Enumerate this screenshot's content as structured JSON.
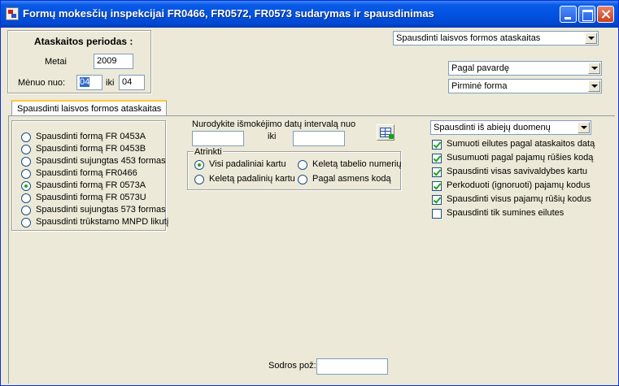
{
  "window": {
    "title": "Formų mokesčių inspekcijai FR0466, FR0572, FR0573 sudarymas  ir spausdinimas"
  },
  "period": {
    "heading": "Ataskaitos periodas :",
    "year_label": "Metai",
    "year_value": "2009",
    "month_from_label": "Mėnuo nuo:",
    "month_from_value": "04",
    "month_to_label": "iki",
    "month_to_value": "04"
  },
  "report_type_select": "Spausdinti laisvos formos ataskaitas",
  "sort_select": "Pagal pavardę",
  "form_select": "Pirminė forma",
  "tab": {
    "label": "Spausdinti laisvos formos ataskaitas"
  },
  "forms": [
    {
      "label": "Spausdinti formą FR 0453A",
      "checked": false
    },
    {
      "label": "Spausdinti formą FR 0453B",
      "checked": false
    },
    {
      "label": "Spausdinti sujungtas 453 formas",
      "checked": false
    },
    {
      "label": "Spausdinti formą FR0466",
      "checked": false
    },
    {
      "label": "Spausdinti formą FR 0573A",
      "checked": true
    },
    {
      "label": "Spausdinti formą FR 0573U",
      "checked": false
    },
    {
      "label": "Spausdinti sujungtas 573 formas",
      "checked": false
    },
    {
      "label": "Spausdinti trūkstamo MNPD likutį",
      "checked": false
    }
  ],
  "date_interval": {
    "label": "Nurodykite išmokėjimo datų intervalą nuo",
    "from_value": "",
    "to_label": "iki",
    "to_value": ""
  },
  "select_group": {
    "title": "Atrinkti",
    "options": [
      {
        "label": "Visi padaliniai kartu",
        "checked": true
      },
      {
        "label": "Keletą tabelio numerių",
        "checked": false
      },
      {
        "label": "Keletą padalinių kartu",
        "checked": false
      },
      {
        "label": "Pagal asmens kodą",
        "checked": false
      }
    ]
  },
  "data_source_select": "Spausdinti iš abiejų duomenų",
  "options": [
    {
      "label": "Sumuoti eilutes pagal ataskaitos datą",
      "checked": true
    },
    {
      "label": "Susumuoti pagal pajamų rūšies kodą",
      "checked": true
    },
    {
      "label": "Spausdinti visas savivaldybes kartu",
      "checked": true
    },
    {
      "label": "Perkoduoti (ignoruoti) pajamų kodus",
      "checked": true
    },
    {
      "label": "Spausdinti visus pajamų rūšių kodus",
      "checked": true
    },
    {
      "label": "Spausdinti tik sumines eilutes",
      "checked": false
    }
  ],
  "ledger_account": {
    "label": "Sodros pož:",
    "value": ""
  },
  "icons": {
    "app": "app-icon",
    "calendar": "calendar-icon",
    "dropdown": "chevron-down-icon"
  }
}
